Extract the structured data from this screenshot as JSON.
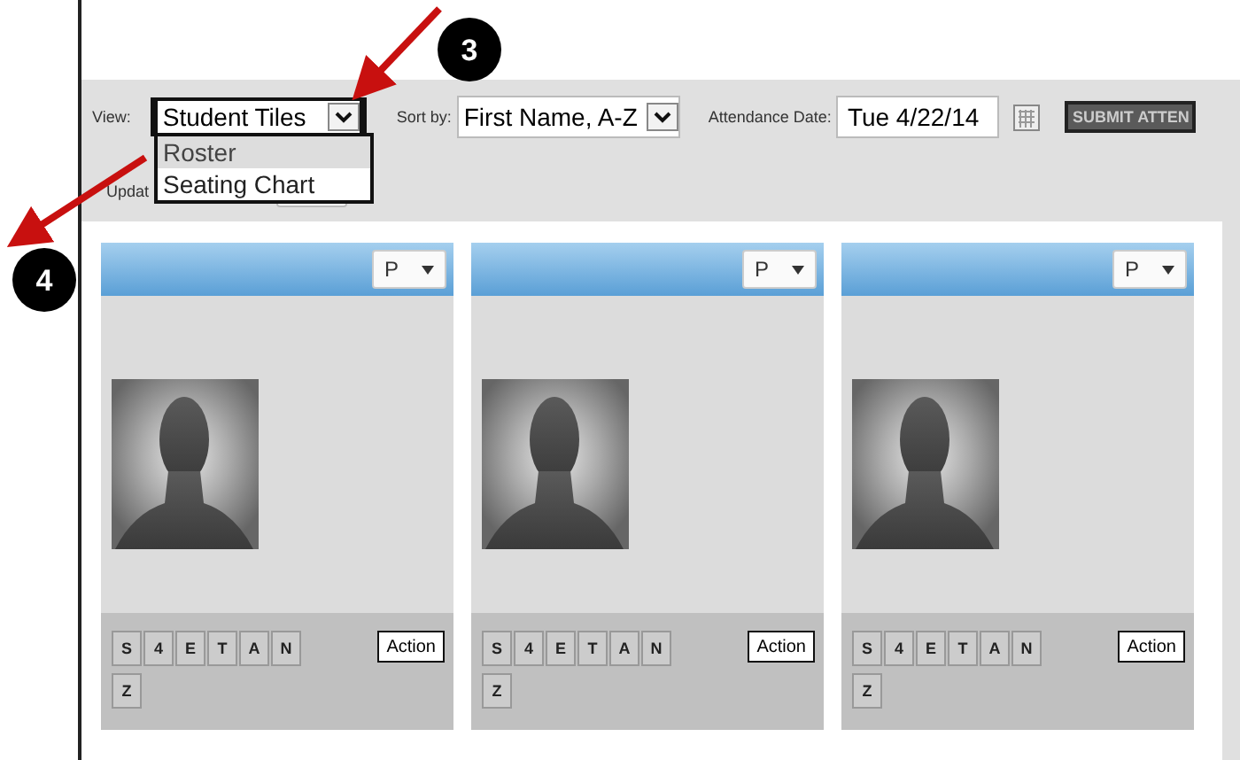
{
  "toolbar": {
    "view_label": "View:",
    "view_select": {
      "value": "Student Tiles",
      "expanded": true,
      "options": [
        {
          "label": "Roster",
          "selected": true
        },
        {
          "label": "Seating Chart",
          "selected": false
        }
      ]
    },
    "sort_label": "Sort by:",
    "sort_select": {
      "value": "First Name, A-Z"
    },
    "date_label": "Attendance Date:",
    "date_field": {
      "value": "Tue 4/22/14"
    },
    "submit_button": "SUBMIT ATTEN"
  },
  "update": {
    "label": "Updat"
  },
  "cards": [
    {
      "status": "P",
      "codes": [
        "S",
        "4",
        "E",
        "T",
        "A",
        "N",
        "Z"
      ],
      "action": "Action"
    },
    {
      "status": "P",
      "codes": [
        "S",
        "4",
        "E",
        "T",
        "A",
        "N",
        "Z"
      ],
      "action": "Action"
    },
    {
      "status": "P",
      "codes": [
        "S",
        "4",
        "E",
        "T",
        "A",
        "N",
        "Z"
      ],
      "action": "Action"
    }
  ],
  "callouts": [
    {
      "label": "3"
    },
    {
      "label": "4"
    }
  ]
}
